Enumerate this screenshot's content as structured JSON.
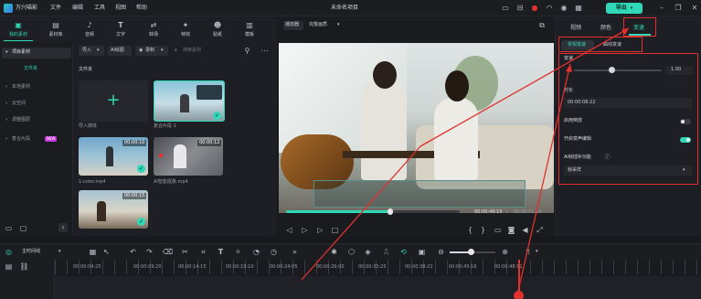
{
  "app": {
    "name": "万兴喵影",
    "project_title": "未命名项目"
  },
  "menu": [
    "文件",
    "编辑",
    "工具",
    "视图",
    "帮助"
  ],
  "export_label": "导出",
  "media_tabs": [
    {
      "label": "我的素材",
      "icon": "media-icon"
    },
    {
      "label": "素材库",
      "icon": "library-icon"
    },
    {
      "label": "音频",
      "icon": "music-icon"
    },
    {
      "label": "文字",
      "icon": "text-icon"
    },
    {
      "label": "转场",
      "icon": "transition-icon"
    },
    {
      "label": "特效",
      "icon": "effects-icon"
    },
    {
      "label": "贴纸",
      "icon": "sticker-icon"
    },
    {
      "label": "模板",
      "icon": "template-icon"
    }
  ],
  "sidebar": {
    "items": [
      "项目素材",
      "文件夹",
      "本地素材",
      "云空间",
      "调整图层",
      "复合片段"
    ],
    "new_badge": "NEW"
  },
  "media_toolbar": {
    "import_label": "导入",
    "ai_label": "AI绘图",
    "record_label": "录制",
    "search_placeholder": "搜索素材"
  },
  "folder_label": "文件夹",
  "media_items": [
    {
      "name": "导入媒体",
      "duration": ""
    },
    {
      "name": "复合片段 1",
      "duration": ""
    },
    {
      "name": "1-color.mp4",
      "duration": "00:00:10"
    },
    {
      "name": "AI智能抠像.mp4",
      "duration": "00:00:12"
    },
    {
      "name": "",
      "duration": "00:00:15"
    }
  ],
  "preview": {
    "quality_label": "播放器",
    "fit_label": "完整画质",
    "current_time": "00:00:49:15",
    "separator": "/",
    "total_time": "00:00:51:19",
    "progress": 0.6
  },
  "right_panel": {
    "tabs": [
      "视频",
      "颜色",
      "变速"
    ],
    "subtabs": [
      "常规变速",
      "曲线变速"
    ],
    "speed_label": "变速",
    "speed_value": "1.00",
    "duration_label": "时长",
    "duration_value": "00:00:08:22",
    "reverse_label": "启用倒放",
    "pitch_label": "开启变声编辑",
    "ai_label": "AI帧插补功能",
    "ai_select": "帧采样"
  },
  "timeline": {
    "track_label": "主时间线",
    "ruler_times": [
      "00:00:04:25",
      "00:00:09:20",
      "00:00:14:15",
      "00:00:19:10",
      "00:00:24:05",
      "00:00:29:00",
      "00:00:33:25",
      "00:00:38:21",
      "00:00:43:16",
      "00:00:48:11"
    ]
  },
  "colors": {
    "accent": "#2fd8b6",
    "annotation": "#e0312f",
    "bg": "#18191d"
  }
}
